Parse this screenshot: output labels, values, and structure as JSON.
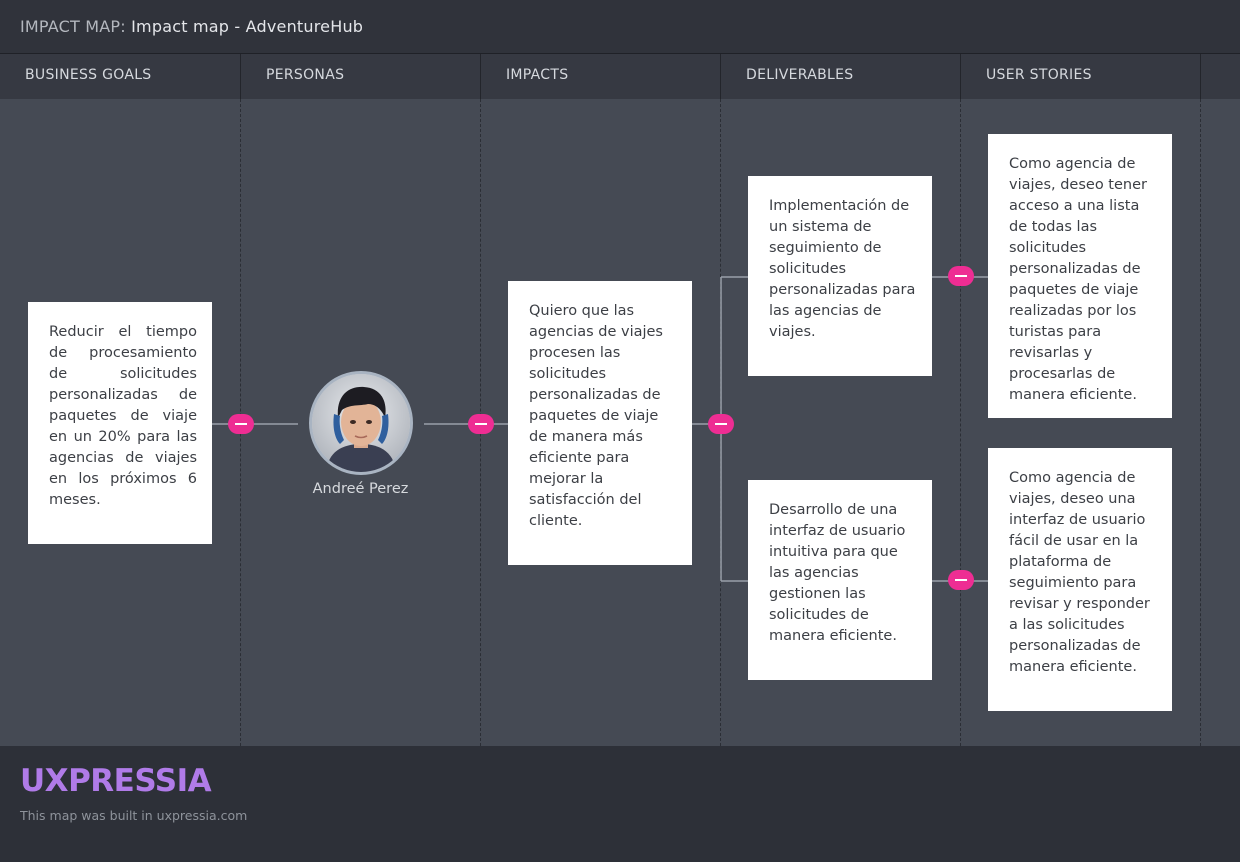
{
  "header": {
    "prefix": "IMPACT MAP:",
    "title": "Impact map - AdventureHub"
  },
  "columns": [
    "BUSINESS GOALS",
    "PERSONAS",
    "IMPACTS",
    "DELIVERABLES",
    "USER STORIES"
  ],
  "business_goal": {
    "text": "Reducir el tiempo de procesamiento de solicitudes personalizadas de paquetes de viaje en un 20% para las agencias de viajes en los próximos 6 meses."
  },
  "persona": {
    "name": "Andreé Perez",
    "avatar_icon": "user-avatar-photo"
  },
  "impact": {
    "text": "Quiero que las agencias de viajes procesen las solicitudes personalizadas de paquetes de viaje de manera más eficiente para mejorar la satisfacción del cliente."
  },
  "deliverables": [
    {
      "text": "Implementación de un sistema de seguimiento de solicitudes personalizadas para las agencias de viajes."
    },
    {
      "text": "Desarrollo de una interfaz de usuario intuitiva para que las agencias gestionen las solicitudes de manera eficiente."
    }
  ],
  "user_stories": [
    {
      "text": "Como agencia de viajes, deseo tener acceso a una lista de todas las solicitudes personalizadas de paquetes de viaje realizadas por los turistas para revisarlas y procesarlas de manera eficiente."
    },
    {
      "text": "Como agencia de viajes, deseo una interfaz de usuario fácil de usar en la plataforma de seguimiento para revisar y responder a las solicitudes personalizadas de manera eficiente."
    }
  ],
  "footer": {
    "logo": "UXPRESSIA",
    "built_text": "This map was built in uxpressia.com"
  },
  "colors": {
    "accent": "#ee2d93",
    "logo": "#b07be8",
    "canvas": "#454a54",
    "header": "#30333b",
    "card": "#ffffff"
  }
}
